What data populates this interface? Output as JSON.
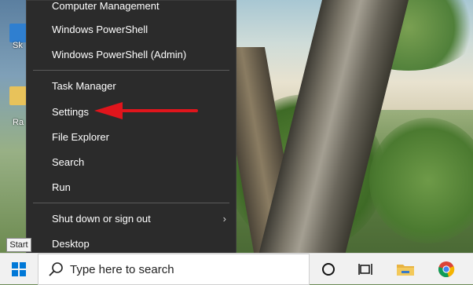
{
  "menu": {
    "items": [
      {
        "label": "Computer Management"
      },
      {
        "label": "Windows PowerShell"
      },
      {
        "label": "Windows PowerShell (Admin)"
      },
      {
        "label": "Task Manager"
      },
      {
        "label": "Settings"
      },
      {
        "label": "File Explorer"
      },
      {
        "label": "Search"
      },
      {
        "label": "Run"
      },
      {
        "label": "Shut down or sign out"
      },
      {
        "label": "Desktop"
      }
    ],
    "submenu_icon": "chevron-right-icon"
  },
  "desktop": {
    "icons": [
      {
        "label": "Sk",
        "icon": "app-shortcut-icon"
      },
      {
        "label": "Ra",
        "icon": "folder-icon"
      }
    ]
  },
  "tooltip": "Start",
  "taskbar": {
    "start_icon": "windows-logo-icon",
    "search_placeholder": "Type here to search",
    "search_icon": "search-icon",
    "icons": [
      "cortana-circle-icon",
      "task-view-icon",
      "file-explorer-icon",
      "chrome-icon"
    ]
  },
  "colors": {
    "menu_bg": "#2b2b2b",
    "arrow": "#e0151c",
    "start_blue": "#0078d7"
  }
}
